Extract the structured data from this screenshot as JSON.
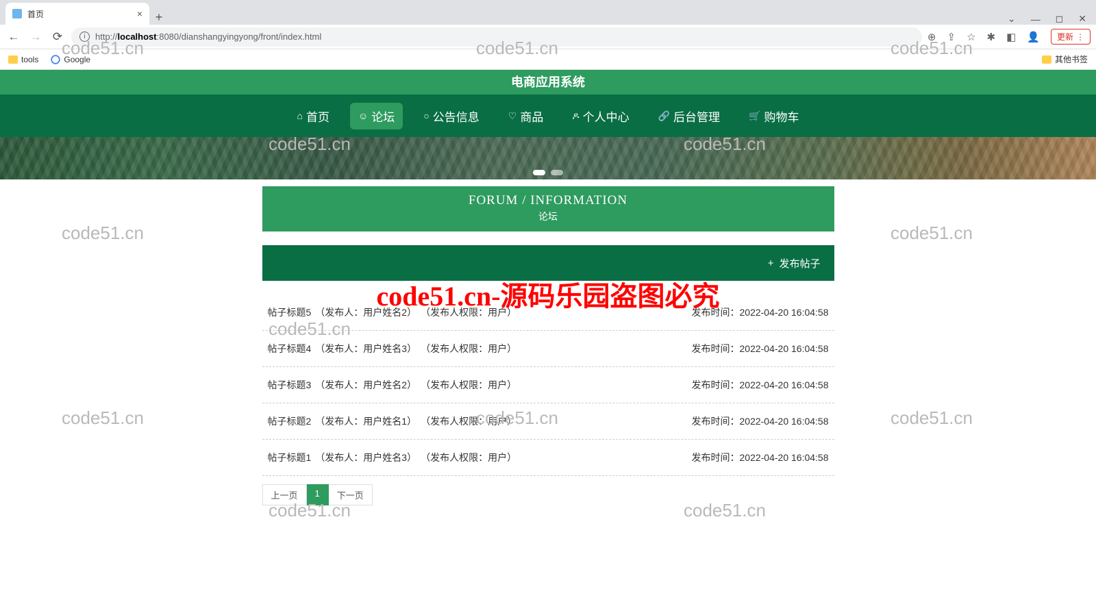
{
  "browser": {
    "tab_title": "首页",
    "url_prefix": "http://",
    "url_host": "localhost",
    "url_rest": ":8080/dianshangyingyong/front/index.html",
    "update_label": "更新",
    "bookmarks": {
      "tools": "tools",
      "google": "Google",
      "other": "其他书签"
    }
  },
  "site": {
    "title": "电商应用系统",
    "nav": [
      {
        "icon": "⌂",
        "label": "首页"
      },
      {
        "icon": "☺",
        "label": "论坛"
      },
      {
        "icon": "○",
        "label": "公告信息"
      },
      {
        "icon": "♡",
        "label": "商品"
      },
      {
        "icon": "ዶ",
        "label": "个人中心"
      },
      {
        "icon": "🔗",
        "label": "后台管理"
      },
      {
        "icon": "🛒",
        "label": "购物车"
      }
    ]
  },
  "forum": {
    "head_en": "FORUM / INFORMATION",
    "head_cn": "论坛",
    "publish_label": "发布帖子",
    "time_label_prefix": "发布时间：",
    "posts": [
      {
        "title": "帖子标题5",
        "publisher": "（发布人：用户姓名2）",
        "role": "（发布人权限：用户）",
        "time": "2022-04-20 16:04:58"
      },
      {
        "title": "帖子标题4",
        "publisher": "（发布人：用户姓名3）",
        "role": "（发布人权限：用户）",
        "time": "2022-04-20 16:04:58"
      },
      {
        "title": "帖子标题3",
        "publisher": "（发布人：用户姓名2）",
        "role": "（发布人权限：用户）",
        "time": "2022-04-20 16:04:58"
      },
      {
        "title": "帖子标题2",
        "publisher": "（发布人：用户姓名1）",
        "role": "（发布人权限：用户）",
        "time": "2022-04-20 16:04:58"
      },
      {
        "title": "帖子标题1",
        "publisher": "（发布人：用户姓名3）",
        "role": "（发布人权限：用户）",
        "time": "2022-04-20 16:04:58"
      }
    ],
    "pager": {
      "prev": "上一页",
      "page": "1",
      "next": "下一页"
    }
  },
  "watermark": {
    "text": "code51.cn",
    "red": "code51.cn-源码乐园盗图必究"
  }
}
